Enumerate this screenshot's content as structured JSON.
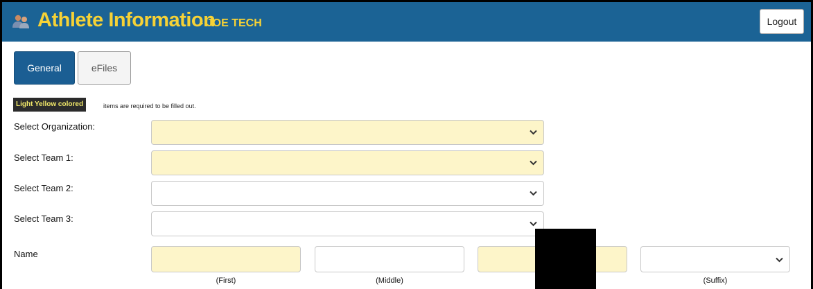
{
  "header": {
    "title": "Athlete Information",
    "user": "- JOE TECH",
    "logout_label": "Logout",
    "icon": "users-icon",
    "bg_color": "#1b6395",
    "title_color": "#f6d236"
  },
  "tabs": [
    {
      "label": "General",
      "active": true
    },
    {
      "label": "eFiles",
      "active": false
    }
  ],
  "legend": {
    "badge": "Light Yellow colored",
    "text": "items are required to be filled out.",
    "required_color": "#fdf5c9"
  },
  "form": {
    "organization_label": "Select Organization:",
    "team1_label": "Select Team 1:",
    "team2_label": "Select Team 2:",
    "team3_label": "Select Team 3:",
    "name_label": "Name",
    "first_label": "(First)",
    "middle_label": "(Middle)",
    "suffix_label": "(Suffix)"
  }
}
